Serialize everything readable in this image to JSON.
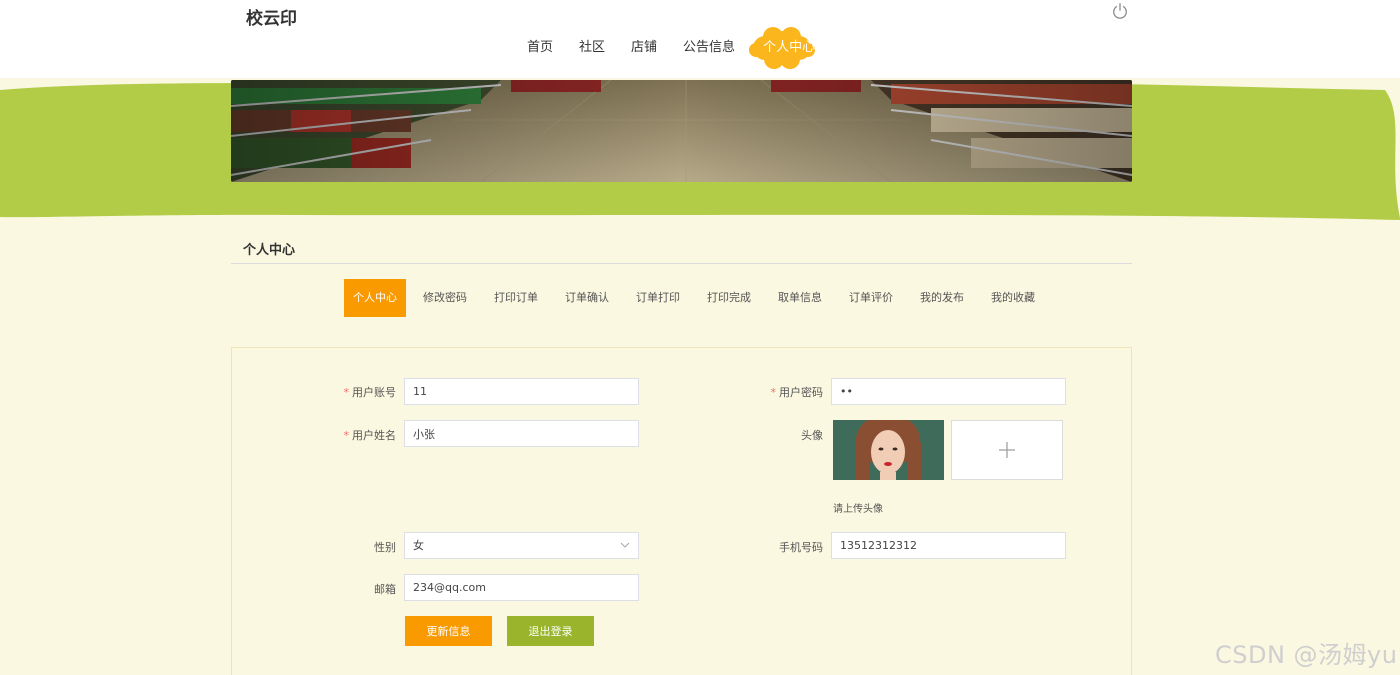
{
  "header": {
    "site_title": "校云印",
    "nav": [
      "首页",
      "社区",
      "店铺",
      "公告信息",
      "个人中心"
    ],
    "nav_active": "个人中心"
  },
  "section": {
    "title": "个人中心"
  },
  "tabs": [
    "个人中心",
    "修改密码",
    "打印订单",
    "订单确认",
    "订单打印",
    "打印完成",
    "取单信息",
    "订单评价",
    "我的发布",
    "我的收藏"
  ],
  "form": {
    "account_label": "用户账号",
    "account_value": "11",
    "password_label": "用户密码",
    "password_value": "••",
    "name_label": "用户姓名",
    "name_value": "小张",
    "avatar_label": "头像",
    "avatar_tip": "请上传头像",
    "gender_label": "性别",
    "gender_value": "女",
    "phone_label": "手机号码",
    "phone_value": "13512312312",
    "email_label": "邮箱",
    "email_value": "234@qq.com",
    "required_mark": "*"
  },
  "buttons": {
    "update": "更新信息",
    "logout": "退出登录"
  },
  "watermark": "CSDN @汤姆yu",
  "colors": {
    "accent_orange": "#f99a00",
    "accent_green": "#9ab52b",
    "band_green": "#b3cc48",
    "page_bg": "#fbf8e1"
  }
}
